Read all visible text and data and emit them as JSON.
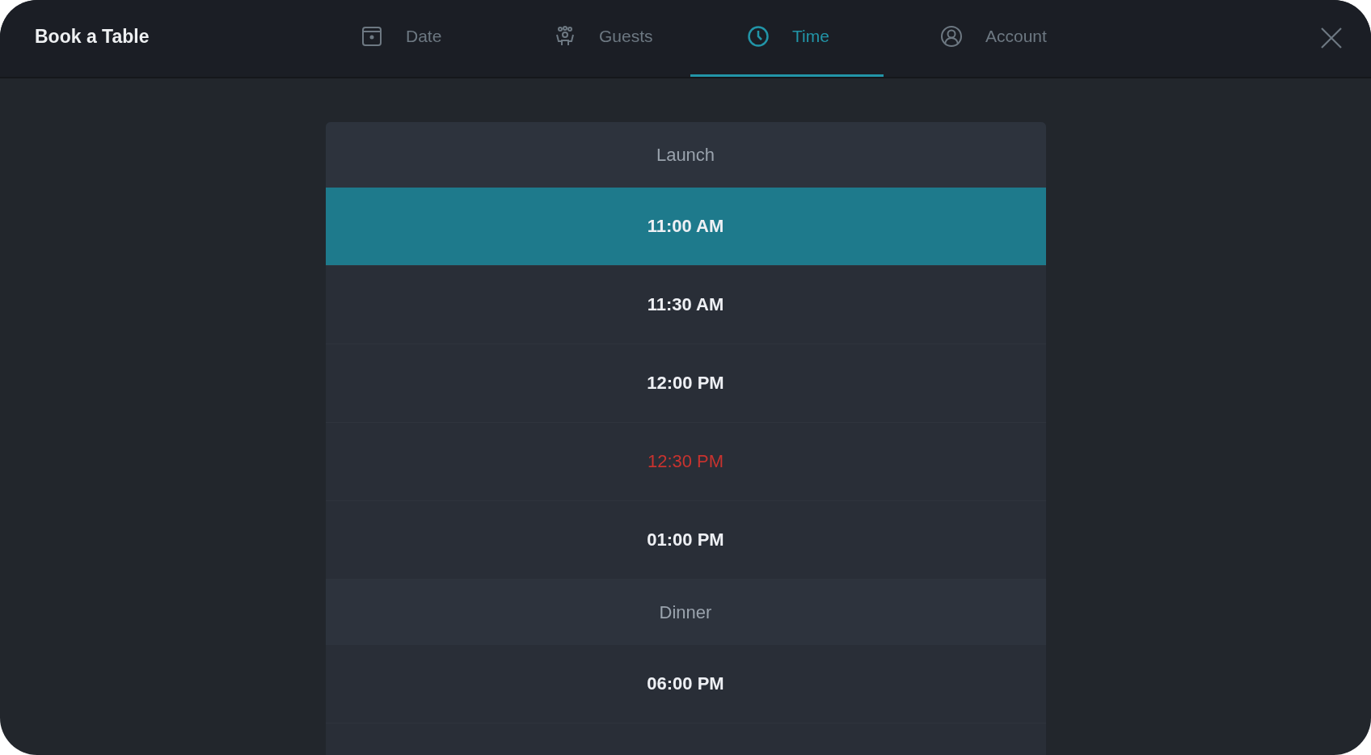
{
  "window": {
    "title": "Book a Table"
  },
  "tabs": [
    {
      "label": "Date",
      "kind": "calendar",
      "selected": false
    },
    {
      "label": "Guests",
      "kind": "guests",
      "selected": false
    },
    {
      "label": "Time",
      "kind": "clock",
      "selected": true
    },
    {
      "label": "Account",
      "kind": "account",
      "selected": false
    }
  ],
  "time_list": [
    {
      "kind": "header",
      "label": "Launch"
    },
    {
      "kind": "slot",
      "label": "11:00 AM",
      "selected": true,
      "unavailable": false
    },
    {
      "kind": "slot",
      "label": "11:30 AM",
      "selected": false,
      "unavailable": false
    },
    {
      "kind": "slot",
      "label": "12:00 PM",
      "selected": false,
      "unavailable": false
    },
    {
      "kind": "slot",
      "label": "12:30 PM",
      "selected": false,
      "unavailable": true
    },
    {
      "kind": "slot",
      "label": "01:00 PM",
      "selected": false,
      "unavailable": false
    },
    {
      "kind": "header",
      "label": "Dinner"
    },
    {
      "kind": "slot",
      "label": "06:00 PM",
      "selected": false,
      "unavailable": false
    }
  ]
}
